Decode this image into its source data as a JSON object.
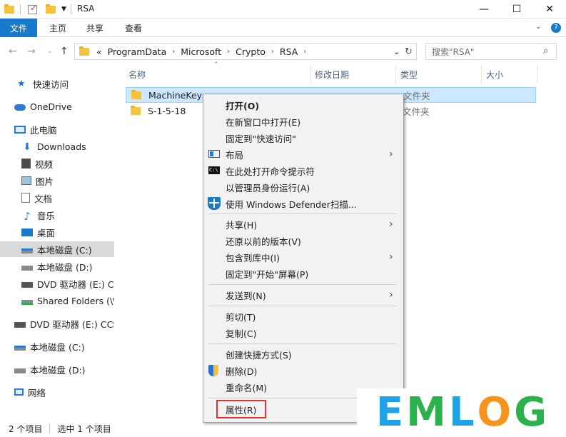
{
  "window": {
    "title": "RSA",
    "min": "—",
    "max": "☐",
    "close": "✕"
  },
  "ribbon": {
    "tabs": [
      "文件",
      "主页",
      "共享",
      "查看"
    ]
  },
  "address": {
    "prefix": "«",
    "crumbs": [
      "ProgramData",
      "Microsoft",
      "Crypto",
      "RSA"
    ],
    "search_placeholder": "搜索\"RSA\""
  },
  "nav": [
    {
      "label": "快速访问",
      "icon": "star-icon"
    },
    {
      "label": "OneDrive",
      "icon": "cloud-icon"
    },
    {
      "label": "此电脑",
      "icon": "computer-icon"
    },
    {
      "label": "Downloads",
      "icon": "download-icon"
    },
    {
      "label": "视频",
      "icon": "video-icon"
    },
    {
      "label": "图片",
      "icon": "picture-icon"
    },
    {
      "label": "文档",
      "icon": "document-icon"
    },
    {
      "label": "音乐",
      "icon": "music-icon"
    },
    {
      "label": "桌面",
      "icon": "desktop-icon"
    },
    {
      "label": "本地磁盘 (C:)",
      "icon": "drive-icon"
    },
    {
      "label": "本地磁盘 (D:)",
      "icon": "drive-icon"
    },
    {
      "label": "DVD 驱动器 (E:) CC",
      "icon": "dvd-icon"
    },
    {
      "label": "Shared Folders (\\\\",
      "icon": "network-drive-icon"
    },
    {
      "label": "DVD 驱动器 (E:) CCS",
      "icon": "dvd-icon"
    },
    {
      "label": "本地磁盘 (C:)",
      "icon": "drive-icon"
    },
    {
      "label": "本地磁盘 (D:)",
      "icon": "drive-icon"
    },
    {
      "label": "网络",
      "icon": "network-icon"
    }
  ],
  "columns": {
    "name": "名称",
    "date": "修改日期",
    "type": "类型",
    "size": "大小"
  },
  "files": [
    {
      "name": "MachineKeys",
      "type": "文件夹"
    },
    {
      "name": "S-1-5-18",
      "type": "文件夹"
    }
  ],
  "context_menu": [
    {
      "label": "打开(O)",
      "bold": true
    },
    {
      "label": "在新窗口中打开(E)"
    },
    {
      "label": "固定到\"快速访问\""
    },
    {
      "label": "布局",
      "icon": "layout-icon",
      "submenu": true
    },
    {
      "label": "在此处打开命令提示符",
      "icon": "cmd-icon"
    },
    {
      "label": "以管理员身份运行(A)"
    },
    {
      "label": "使用 Windows Defender扫描...",
      "icon": "defender-shield-icon"
    },
    {
      "label": "共享(H)",
      "submenu": true
    },
    {
      "label": "还原以前的版本(V)"
    },
    {
      "label": "包含到库中(I)",
      "submenu": true
    },
    {
      "label": "固定到\"开始\"屏幕(P)"
    },
    {
      "label": "发送到(N)",
      "submenu": true
    },
    {
      "label": "剪切(T)"
    },
    {
      "label": "复制(C)"
    },
    {
      "label": "创建快捷方式(S)"
    },
    {
      "label": "删除(D)",
      "icon": "uac-shield-icon"
    },
    {
      "label": "重命名(M)"
    },
    {
      "label": "属性(R)"
    }
  ],
  "status": {
    "count": "2 个项目",
    "selected": "选中 1 个项目"
  },
  "watermark": {
    "letters": [
      "E",
      "M",
      "L",
      "O",
      "G"
    ],
    "colors": [
      "#1fa3e8",
      "#2bb24c",
      "#1fa3e8",
      "#f7941d",
      "#2bb24c"
    ]
  }
}
